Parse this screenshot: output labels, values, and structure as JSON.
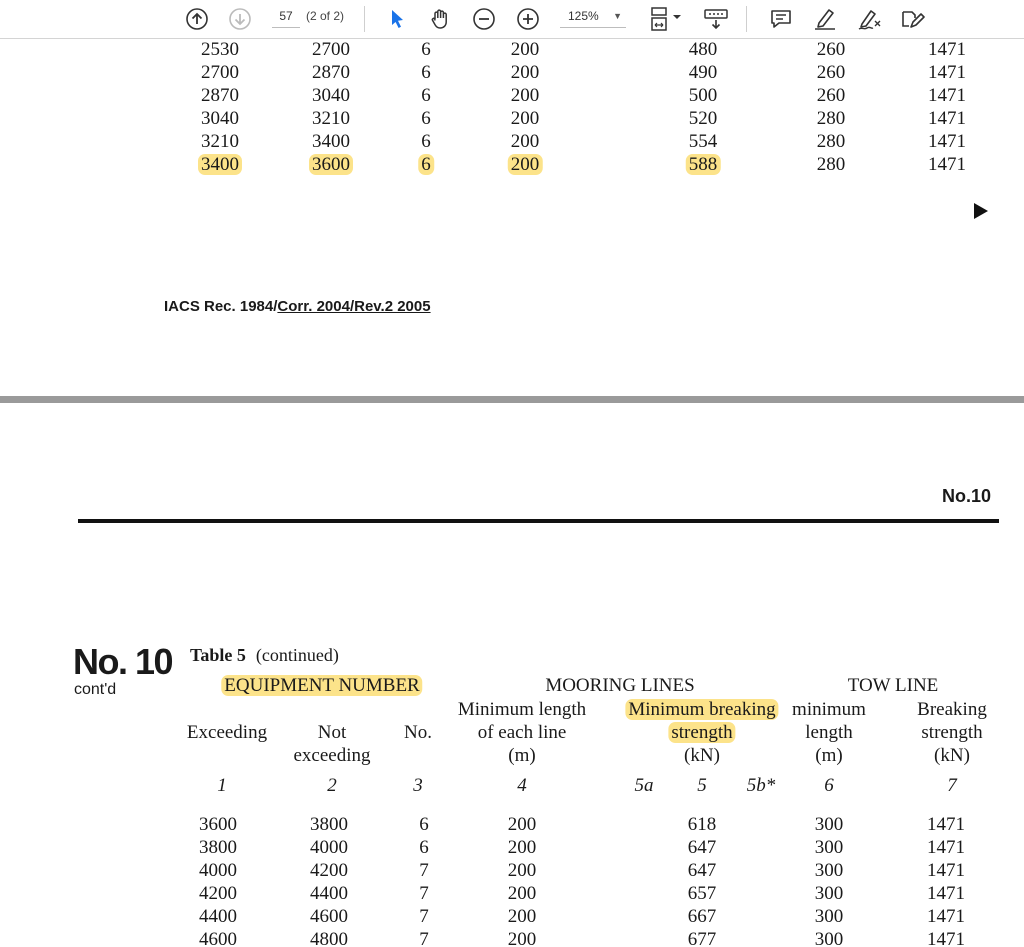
{
  "toolbar": {
    "page_number": "57",
    "page_total": "(2 of 2)",
    "zoom": "125%",
    "icons": [
      "prev-page-icon",
      "next-page-icon",
      "select-cursor-icon",
      "hand-tool-icon",
      "zoom-out-icon",
      "zoom-in-icon",
      "fit-page-icon",
      "scroll-mode-icon",
      "comment-icon",
      "highlight-icon",
      "draw-icon",
      "sign-icon"
    ]
  },
  "page1": {
    "rows": [
      [
        "2530",
        "2700",
        "6",
        "200",
        "480",
        "260",
        "1471"
      ],
      [
        "2700",
        "2870",
        "6",
        "200",
        "490",
        "260",
        "1471"
      ],
      [
        "2870",
        "3040",
        "6",
        "200",
        "500",
        "260",
        "1471"
      ],
      [
        "3040",
        "3210",
        "6",
        "200",
        "520",
        "280",
        "1471"
      ],
      [
        "3210",
        "3400",
        "6",
        "200",
        "554",
        "280",
        "1471"
      ],
      [
        "3400",
        "3600",
        "6",
        "200",
        "588",
        "280",
        "1471"
      ]
    ],
    "footer_plain": "IACS Rec. 1984/",
    "footer_underlined": "Corr. 2004/Rev.2 2005"
  },
  "page2": {
    "tag": "No.10",
    "big_title": "No. 10",
    "contd": "cont'd",
    "table_title_bold": "Table 5",
    "table_title_note": "(continued)",
    "headers": {
      "equipment_number": "EQUIPMENT NUMBER",
      "mooring_lines": "MOORING LINES",
      "tow_line": "TOW LINE",
      "exceeding": "Exceeding",
      "not_exceeding_1": "Not",
      "not_exceeding_2": "exceeding",
      "no": "No.",
      "min_length_1": "Minimum length",
      "min_length_2": "of each line",
      "min_length_3": "(m)",
      "min_breaking_1": "Minimum breaking",
      "min_breaking_2": "strength",
      "min_breaking_3": "(kN)",
      "tow_min_1": "minimum",
      "tow_min_2": "length",
      "tow_min_3": "(m)",
      "tow_break_1": "Breaking",
      "tow_break_2": "strength",
      "tow_break_3": "(kN)"
    },
    "col_numbers": [
      "1",
      "2",
      "3",
      "4",
      "5a",
      "5",
      "5b*",
      "6",
      "7"
    ],
    "rows": [
      [
        "3600",
        "3800",
        "6",
        "200",
        "618",
        "300",
        "1471"
      ],
      [
        "3800",
        "4000",
        "6",
        "200",
        "647",
        "300",
        "1471"
      ],
      [
        "4000",
        "4200",
        "7",
        "200",
        "647",
        "300",
        "1471"
      ],
      [
        "4200",
        "4400",
        "7",
        "200",
        "657",
        "300",
        "1471"
      ],
      [
        "4400",
        "4600",
        "7",
        "200",
        "667",
        "300",
        "1471"
      ],
      [
        "4600",
        "4800",
        "7",
        "200",
        "677",
        "300",
        "1471"
      ]
    ]
  },
  "colors": {
    "highlight": "#fce38a",
    "accent_blue": "#1a73e8"
  }
}
